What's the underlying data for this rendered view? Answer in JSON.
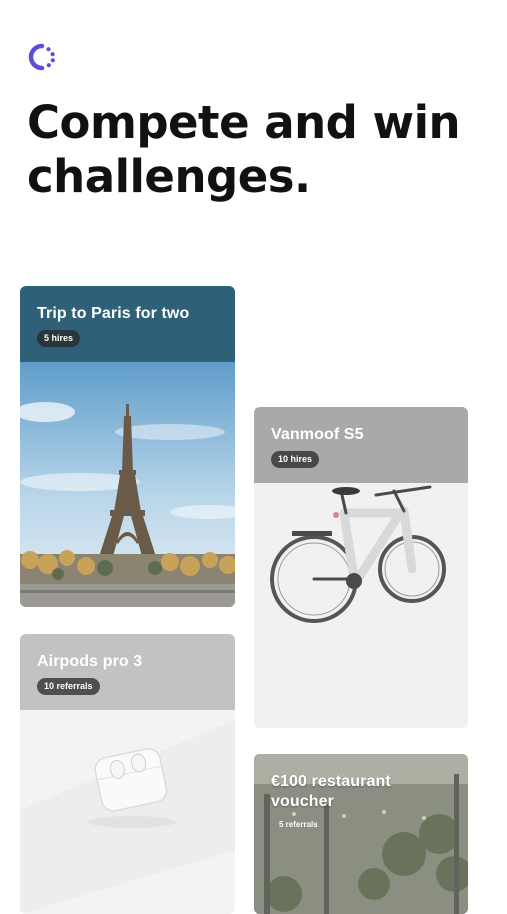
{
  "logo": {
    "icon": "spinner-logo-icon",
    "color": "#5b4fd8"
  },
  "headline": "Compete and win challenges.",
  "cards": [
    {
      "title": "Trip to Paris for two",
      "badge": "5 hires",
      "image": "eiffel-tower-image",
      "header_color": "#2e6177"
    },
    {
      "title": "Vanmoof S5",
      "badge": "10 hires",
      "image": "bicycle-image",
      "header_color": "#a9a9a9"
    },
    {
      "title": "Airpods pro 3",
      "badge": "10 referrals",
      "image": "airpods-case-image",
      "header_color": "#c2c2c2"
    },
    {
      "title": "€100 restaurant voucher",
      "badge": "5 referrals",
      "image": "restaurant-terrace-image"
    }
  ]
}
